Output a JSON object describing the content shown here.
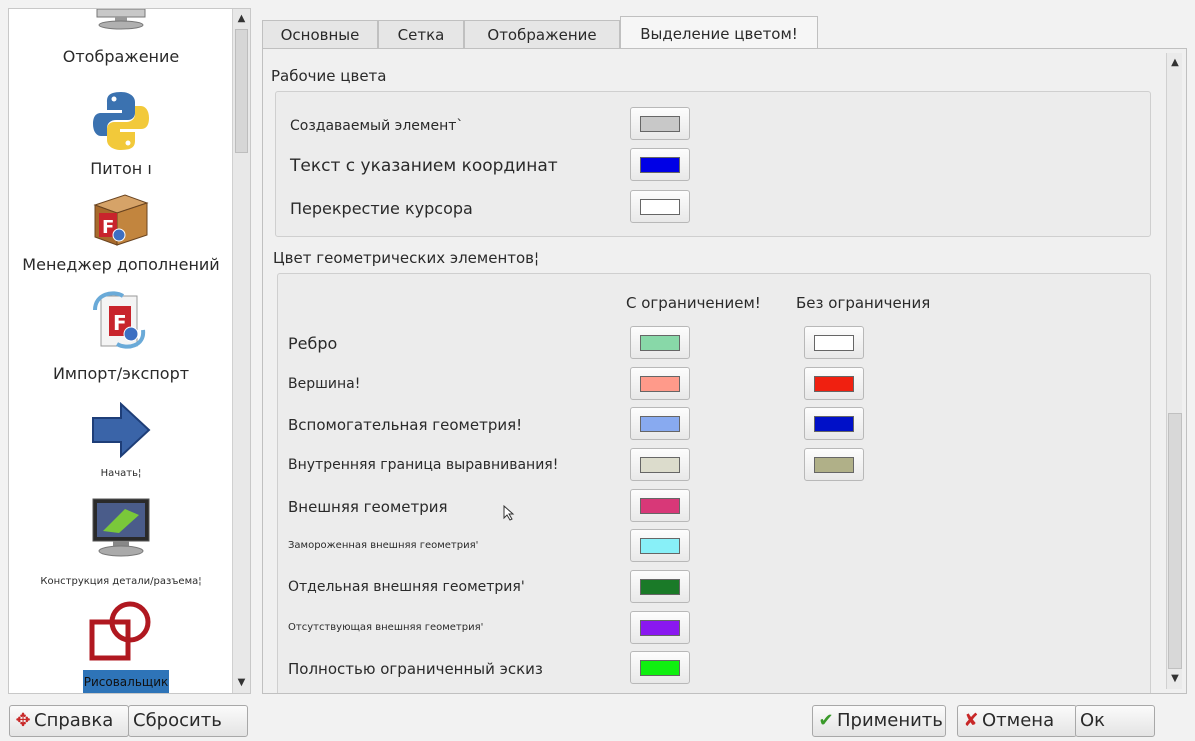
{
  "sidebar": {
    "items": [
      {
        "label": "Отображение",
        "icon": "monitor-icon"
      },
      {
        "label": "Питон ı",
        "icon": "python-icon"
      },
      {
        "label": "Менеджер дополнений",
        "icon": "addon-manager-icon"
      },
      {
        "label": "Импорт/экспорт",
        "icon": "import-export-icon"
      },
      {
        "label": "Начать¦",
        "icon": "arrow-right-icon"
      },
      {
        "label": "Конструкция детали/разъема¦",
        "icon": "part-design-icon"
      },
      {
        "label": "Рисовальщик",
        "icon": "draft-icon"
      }
    ]
  },
  "tabs": [
    {
      "label": "Основные"
    },
    {
      "label": "Сетка"
    },
    {
      "label": "Отображение"
    },
    {
      "label": "Выделение цветом!"
    }
  ],
  "working_colors": {
    "title": "Рабочие цвета",
    "rows": [
      {
        "label": "Создаваемый элемент`",
        "color": "#c8c8c8"
      },
      {
        "label": "Текст с указанием координат",
        "color": "#0000e6"
      },
      {
        "label": "Перекрестие курсора",
        "color": "#ffffff"
      }
    ]
  },
  "geometry_colors": {
    "title": "Цвет геометрических элементов¦",
    "col_constrained": "С ограничением!",
    "col_unconstrained": "Без ограничения",
    "rows": [
      {
        "label": "Ребро",
        "constrained": "#88d8a8",
        "unconstrained": "#ffffff"
      },
      {
        "label": "Вершина!",
        "constrained": "#ff9a8a",
        "unconstrained": "#f02010"
      },
      {
        "label": "Вспомогательная геометрия!",
        "constrained": "#88aaf0",
        "unconstrained": "#0010c8"
      },
      {
        "label": "Внутренняя граница выравнивания!",
        "constrained": "#dcdccc",
        "unconstrained": "#b0b088"
      },
      {
        "label": "Внешняя геометрия",
        "constrained": "#d83878"
      },
      {
        "label": "Замороженная внешняя геометрия'",
        "constrained": "#88f0f8"
      },
      {
        "label": "Отдельная внешняя геометрия'",
        "constrained": "#1a7a28"
      },
      {
        "label": "Отсутствующая внешняя геометрия'",
        "constrained": "#8a18f0"
      },
      {
        "label": "Полностью ограниченный эскиз",
        "constrained": "#10f010"
      }
    ]
  },
  "buttons": {
    "help": "Справка",
    "reset": "Сбросить",
    "apply": "Применить",
    "cancel": "Отмена",
    "ok": "Ок"
  }
}
